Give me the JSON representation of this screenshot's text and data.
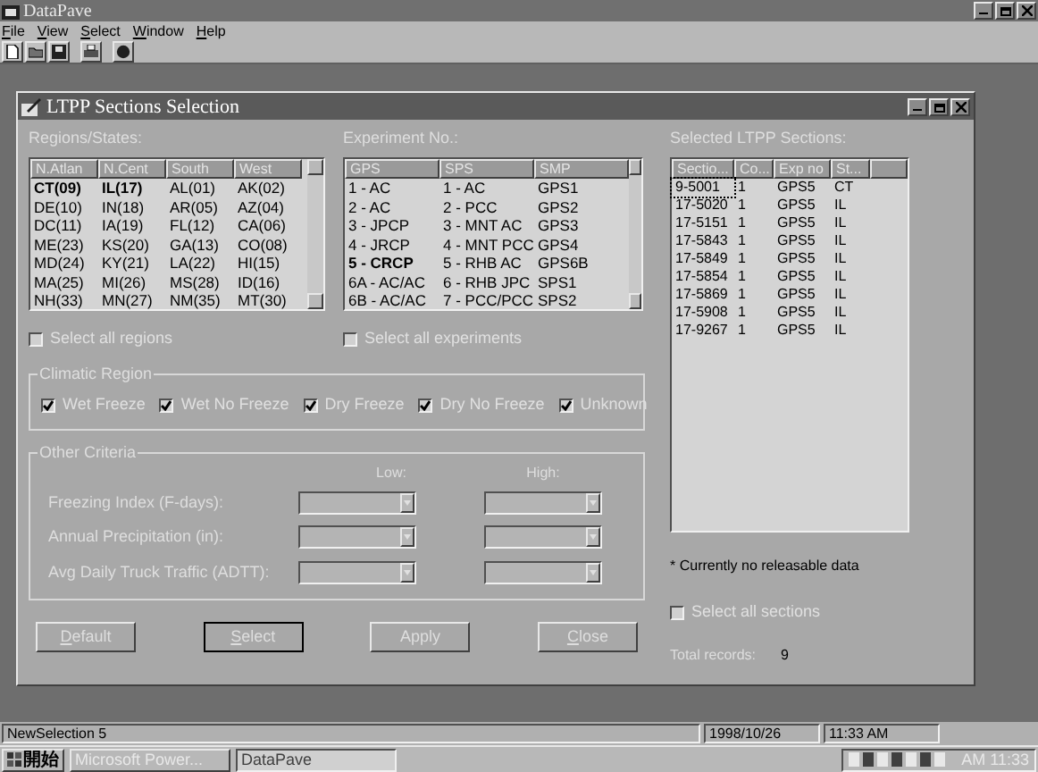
{
  "app": {
    "title": "DataPave"
  },
  "menu": [
    "File",
    "View",
    "Select",
    "Window",
    "Help"
  ],
  "dialog": {
    "title": "LTPP Sections Selection",
    "regions": {
      "label": "Regions/States:",
      "columns": [
        {
          "header": "N.Atlan",
          "items": [
            {
              "text": "CT(09)",
              "selected": true
            },
            {
              "text": "DE(10)",
              "selected": false
            },
            {
              "text": "DC(11)",
              "selected": false
            },
            {
              "text": "ME(23)",
              "selected": false
            },
            {
              "text": "MD(24)",
              "selected": false
            },
            {
              "text": "MA(25)",
              "selected": false
            },
            {
              "text": "NH(33)",
              "selected": false
            }
          ]
        },
        {
          "header": "N.Cent",
          "items": [
            {
              "text": "IL(17)",
              "selected": true
            },
            {
              "text": "IN(18)",
              "selected": false
            },
            {
              "text": "IA(19)",
              "selected": false
            },
            {
              "text": "KS(20)",
              "selected": false
            },
            {
              "text": "KY(21)",
              "selected": false
            },
            {
              "text": "MI(26)",
              "selected": false
            },
            {
              "text": "MN(27)",
              "selected": false
            }
          ]
        },
        {
          "header": "South",
          "items": [
            {
              "text": "AL(01)",
              "selected": false
            },
            {
              "text": "AR(05)",
              "selected": false
            },
            {
              "text": "FL(12)",
              "selected": false
            },
            {
              "text": "GA(13)",
              "selected": false
            },
            {
              "text": "LA(22)",
              "selected": false
            },
            {
              "text": "MS(28)",
              "selected": false
            },
            {
              "text": "NM(35)",
              "selected": false
            }
          ]
        },
        {
          "header": "West",
          "items": [
            {
              "text": "AK(02)",
              "selected": false
            },
            {
              "text": "AZ(04)",
              "selected": false
            },
            {
              "text": "CA(06)",
              "selected": false
            },
            {
              "text": "CO(08)",
              "selected": false
            },
            {
              "text": "HI(15)",
              "selected": false
            },
            {
              "text": "ID(16)",
              "selected": false
            },
            {
              "text": "MT(30)",
              "selected": false
            }
          ]
        }
      ],
      "select_all": {
        "label": "Select all regions",
        "checked": false
      }
    },
    "experiments": {
      "label": "Experiment No.:",
      "columns": [
        {
          "header": "GPS",
          "items": [
            {
              "text": "1 - AC",
              "selected": false
            },
            {
              "text": "2 - AC",
              "selected": false
            },
            {
              "text": "3 - JPCP",
              "selected": false
            },
            {
              "text": "4 - JRCP",
              "selected": false
            },
            {
              "text": "5 - CRCP",
              "selected": true
            },
            {
              "text": "6A - AC/AC",
              "selected": false
            },
            {
              "text": "6B - AC/AC",
              "selected": false
            }
          ]
        },
        {
          "header": "SPS",
          "items": [
            {
              "text": "1 - AC",
              "selected": false
            },
            {
              "text": "2 - PCC",
              "selected": false
            },
            {
              "text": "3 - MNT AC",
              "selected": false
            },
            {
              "text": "4 - MNT PCC",
              "selected": false
            },
            {
              "text": "5 - RHB AC",
              "selected": false
            },
            {
              "text": "6 - RHB JPC",
              "selected": false
            },
            {
              "text": "7 - PCC/PCC",
              "selected": false
            }
          ]
        },
        {
          "header": "SMP",
          "items": [
            {
              "text": "GPS1",
              "selected": false
            },
            {
              "text": "GPS2",
              "selected": false
            },
            {
              "text": "GPS3",
              "selected": false
            },
            {
              "text": "GPS4",
              "selected": false
            },
            {
              "text": "GPS6B",
              "selected": false
            },
            {
              "text": "SPS1",
              "selected": false
            },
            {
              "text": "SPS2",
              "selected": false
            }
          ]
        }
      ],
      "select_all": {
        "label": "Select all experiments",
        "checked": false
      }
    },
    "climatic_region": {
      "title": "Climatic Region",
      "options": [
        {
          "label": "Wet Freeze",
          "checked": true
        },
        {
          "label": "Wet No Freeze",
          "checked": true
        },
        {
          "label": "Dry Freeze",
          "checked": true
        },
        {
          "label": "Dry No Freeze",
          "checked": true
        },
        {
          "label": "Unknown",
          "checked": true
        }
      ]
    },
    "other_criteria": {
      "title": "Other Criteria",
      "low_label": "Low:",
      "high_label": "High:",
      "rows": [
        "Freezing Index (F-days):",
        "Annual Precipitation (in):",
        "Avg Daily Truck Traffic (ADTT):"
      ]
    },
    "buttons": [
      {
        "label": "Default",
        "mnemonic": true,
        "default": false
      },
      {
        "label": "Select",
        "mnemonic": true,
        "default": true
      },
      {
        "label": "Apply",
        "mnemonic": false,
        "default": false
      },
      {
        "label": "Close",
        "mnemonic": true,
        "default": false
      }
    ],
    "sections": {
      "label": "Selected LTPP Sections:",
      "columns": [
        "Sectio...",
        "Co...",
        "Exp no",
        "St..."
      ],
      "rows": [
        {
          "cells": [
            "9-5001",
            "1",
            "GPS5",
            "CT"
          ],
          "selected": true
        },
        {
          "cells": [
            "17-5020",
            "1",
            "GPS5",
            "IL"
          ],
          "selected": false
        },
        {
          "cells": [
            "17-5151",
            "1",
            "GPS5",
            "IL"
          ],
          "selected": false
        },
        {
          "cells": [
            "17-5843",
            "1",
            "GPS5",
            "IL"
          ],
          "selected": false
        },
        {
          "cells": [
            "17-5849",
            "1",
            "GPS5",
            "IL"
          ],
          "selected": false
        },
        {
          "cells": [
            "17-5854",
            "1",
            "GPS5",
            "IL"
          ],
          "selected": false
        },
        {
          "cells": [
            "17-5869",
            "1",
            "GPS5",
            "IL"
          ],
          "selected": false
        },
        {
          "cells": [
            "17-5908",
            "1",
            "GPS5",
            "IL"
          ],
          "selected": false
        },
        {
          "cells": [
            "17-9267",
            "1",
            "GPS5",
            "IL"
          ],
          "selected": false
        }
      ],
      "note": "* Currently no releasable data",
      "select_all": {
        "label": "Select all sections",
        "checked": false
      },
      "total_label": "Total records:",
      "total": "9"
    }
  },
  "status_bar": [
    "NewSelection 5",
    "1998/10/26",
    "11:33 AM"
  ],
  "taskbar": {
    "start": "開始",
    "tasks": [
      "Microsoft Power...",
      "DataPave"
    ],
    "clock": "AM 11:33"
  }
}
